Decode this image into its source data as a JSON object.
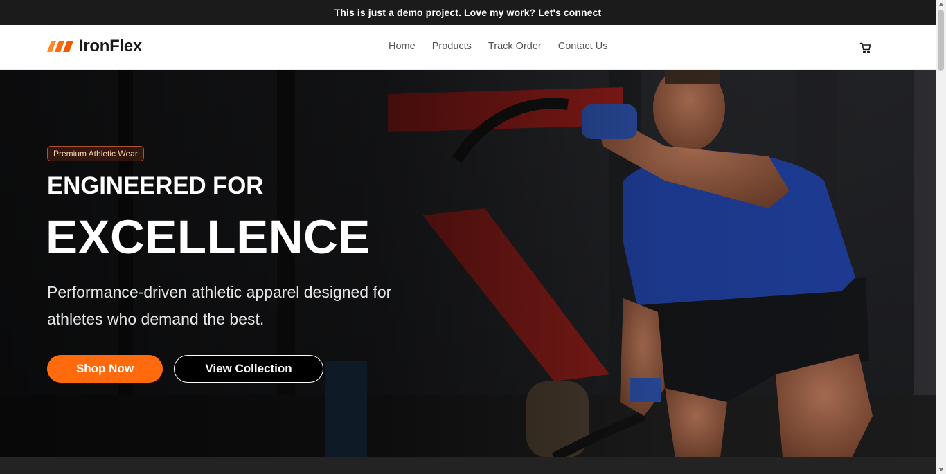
{
  "announcement": {
    "text": "This is just a demo project. Love my work?",
    "link_label": "Let's connect"
  },
  "brand": {
    "name": "IronFlex",
    "logo_icon": "slanted-stripes-logo-icon",
    "accent_color": "#ff6a0d"
  },
  "nav": {
    "links": [
      {
        "label": "Home"
      },
      {
        "label": "Products"
      },
      {
        "label": "Track Order"
      },
      {
        "label": "Contact Us"
      }
    ],
    "cart_icon": "cart-icon"
  },
  "hero": {
    "badge": "Premium Athletic Wear",
    "subtitle": "ENGINEERED FOR",
    "title": "EXCELLENCE",
    "description": "Performance-driven athletic apparel designed for athletes who demand the best.",
    "primary_cta": "Shop Now",
    "secondary_cta": "View Collection",
    "background_image": "athlete-battle-ropes-photo"
  }
}
